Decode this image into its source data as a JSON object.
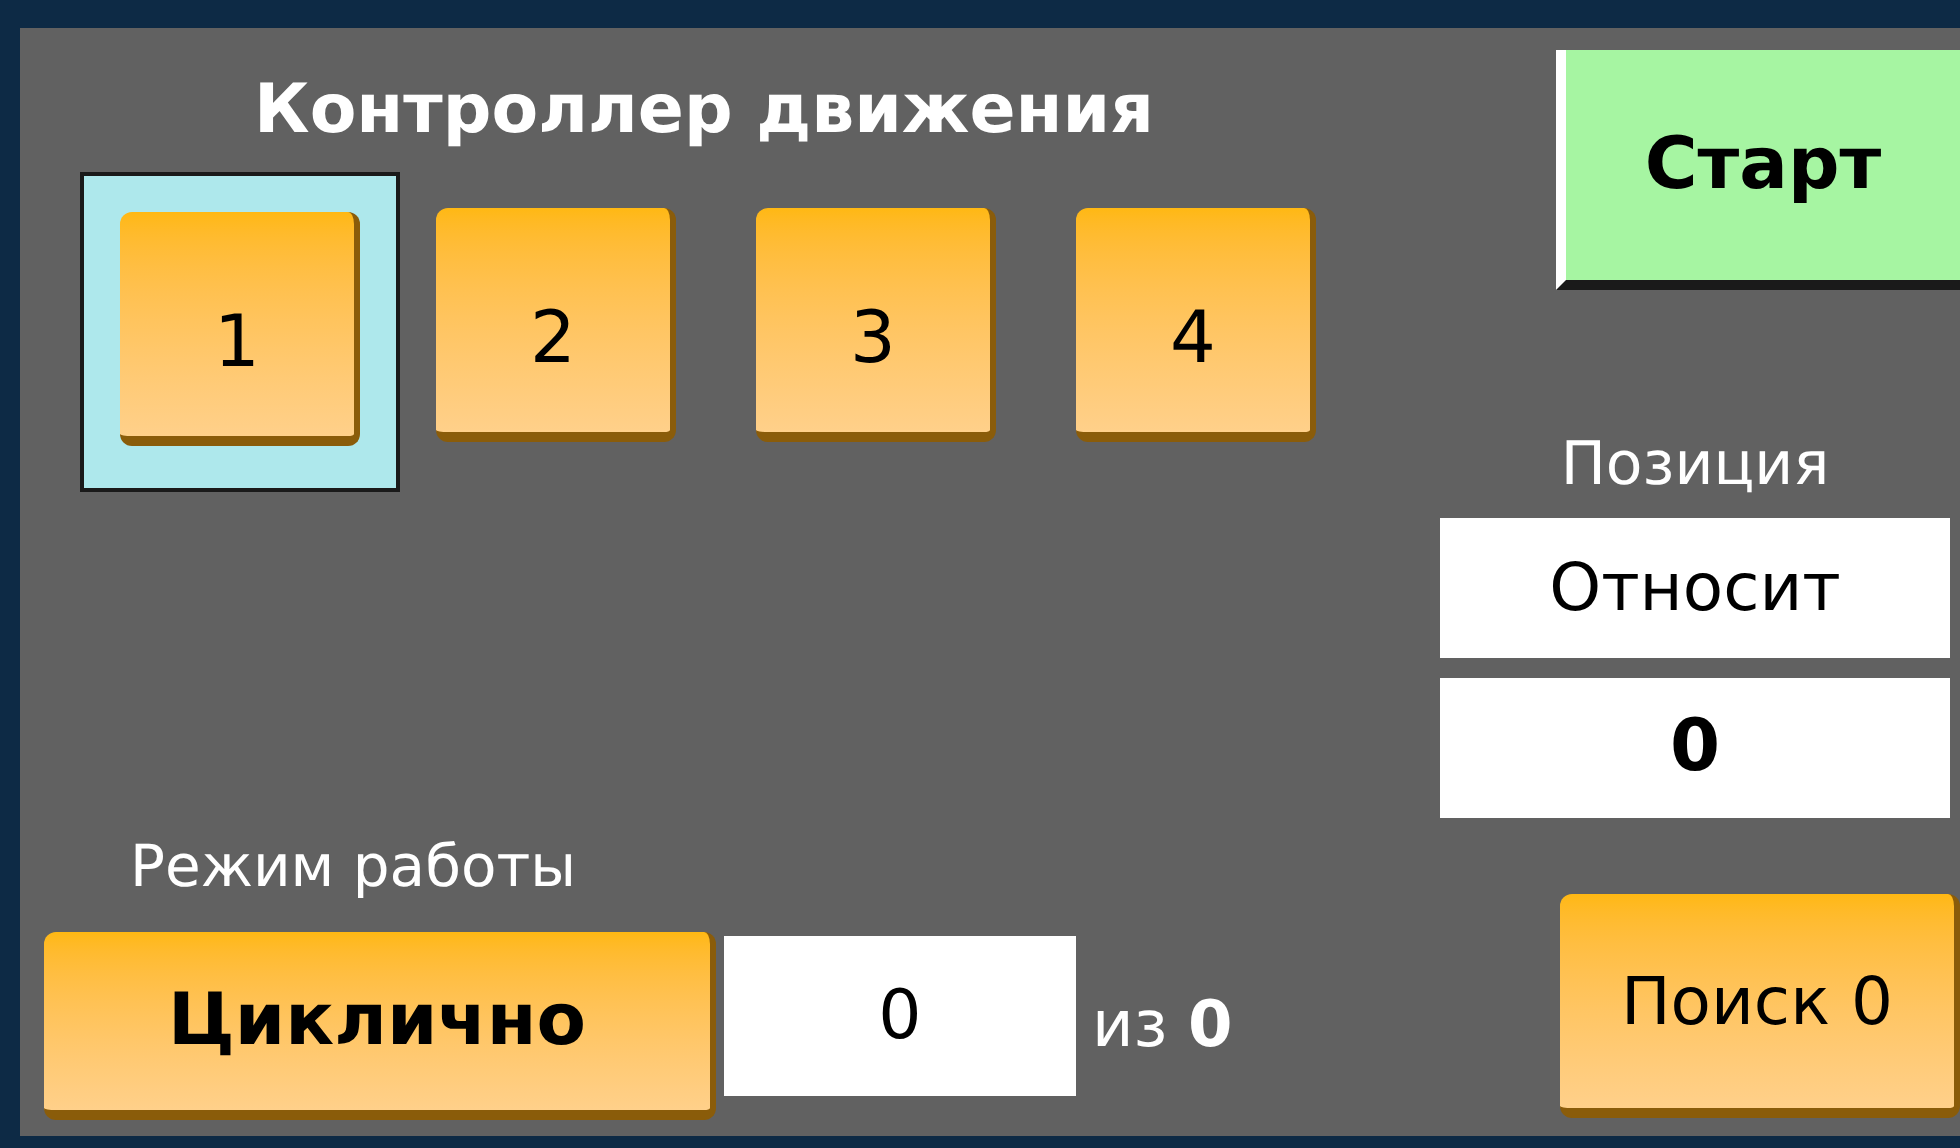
{
  "title": "Контроллер движения",
  "axes": [
    {
      "label": "1",
      "selected": true
    },
    {
      "label": "2",
      "selected": false
    },
    {
      "label": "3",
      "selected": false
    },
    {
      "label": "4",
      "selected": false
    }
  ],
  "start_button": "Старт",
  "position": {
    "label": "Позиция",
    "mode": "Относит",
    "value": "0"
  },
  "work_mode": {
    "label": "Режим работы",
    "button": "Циклично",
    "count": "0",
    "of_label": "из **0**"
  },
  "search_button": "Поиск 0"
}
